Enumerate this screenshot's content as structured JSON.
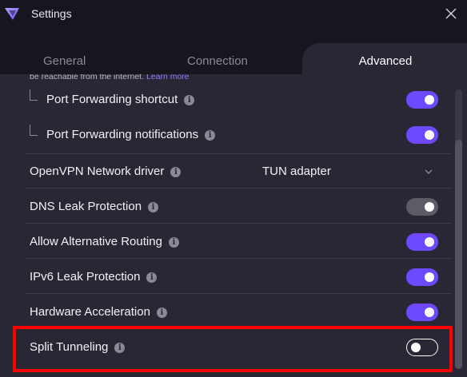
{
  "window": {
    "title": "Settings"
  },
  "tabs": [
    {
      "label": "General"
    },
    {
      "label": "Connection"
    },
    {
      "label": "Advanced",
      "active": true
    }
  ],
  "hint": {
    "text": "be reachable from the internet.",
    "link": "Learn more"
  },
  "settings": {
    "port_forwarding_shortcut": {
      "label": "Port Forwarding shortcut",
      "state": "on"
    },
    "port_forwarding_notifications": {
      "label": "Port Forwarding notifications",
      "state": "on"
    },
    "openvpn_driver": {
      "label": "OpenVPN Network driver",
      "value": "TUN adapter"
    },
    "dns_leak_protection": {
      "label": "DNS Leak Protection",
      "state": "on-disabled"
    },
    "alternative_routing": {
      "label": "Allow Alternative Routing",
      "state": "on"
    },
    "ipv6_leak_protection": {
      "label": "IPv6 Leak Protection",
      "state": "on"
    },
    "hardware_acceleration": {
      "label": "Hardware Acceleration",
      "state": "on"
    },
    "split_tunneling": {
      "label": "Split Tunneling",
      "state": "off"
    }
  },
  "colors": {
    "accent": "#6d4aff",
    "background": "#292733",
    "titlebar": "#17161e",
    "highlight": "#ff0000"
  }
}
